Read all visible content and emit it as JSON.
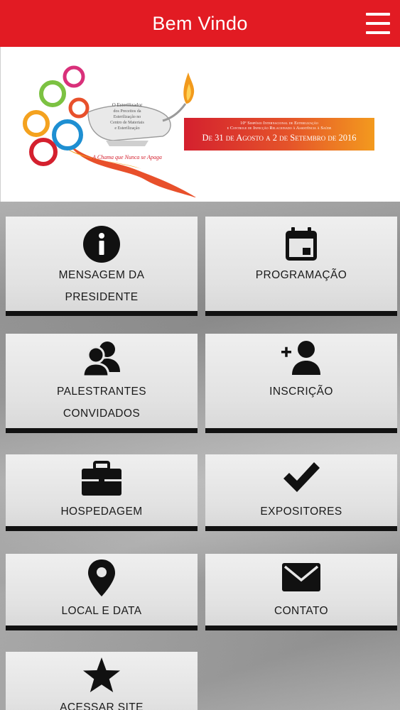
{
  "header": {
    "title": "Bem Vindo",
    "menu_icon": "hamburger-menu-icon",
    "background_color": "#e21b23"
  },
  "banner": {
    "logo_line1": "O Esterilizador",
    "logo_line2": "dos Preceitos da",
    "logo_line3": "Esterilização no",
    "logo_line4": "Centro de Materiais",
    "logo_line5": "e Esterilização",
    "tagline": "A Chama que Nunca se Apaga",
    "event_line1": "10º Simpósio Internacional de Esterilização",
    "event_line2": "e Controle de Infecção Relacionado à Assistência à Saúde",
    "event_dates": "De 31 de Agosto a 2 de Setembro de 2016"
  },
  "tiles": [
    {
      "icon": "info-icon",
      "line1": "MENSAGEM DA",
      "line2": "PRESIDENTE"
    },
    {
      "icon": "calendar-icon",
      "line1": "PROGRAMAÇÃO",
      "line2": ""
    },
    {
      "icon": "people-group-icon",
      "line1": "PALESTRANTES",
      "line2": "CONVIDADOS"
    },
    {
      "icon": "add-user-icon",
      "line1": "INSCRIÇÃO",
      "line2": ""
    },
    {
      "icon": "briefcase-icon",
      "line1": "HOSPEDAGEM",
      "line2": ""
    },
    {
      "icon": "checkmark-icon",
      "line1": "EXPOSITORES",
      "line2": ""
    },
    {
      "icon": "map-pin-icon",
      "line1": "LOCAL E DATA",
      "line2": ""
    },
    {
      "icon": "envelope-icon",
      "line1": "CONTATO",
      "line2": ""
    },
    {
      "icon": "star-icon",
      "line1": "ACESSAR SITE",
      "line2": ""
    }
  ]
}
